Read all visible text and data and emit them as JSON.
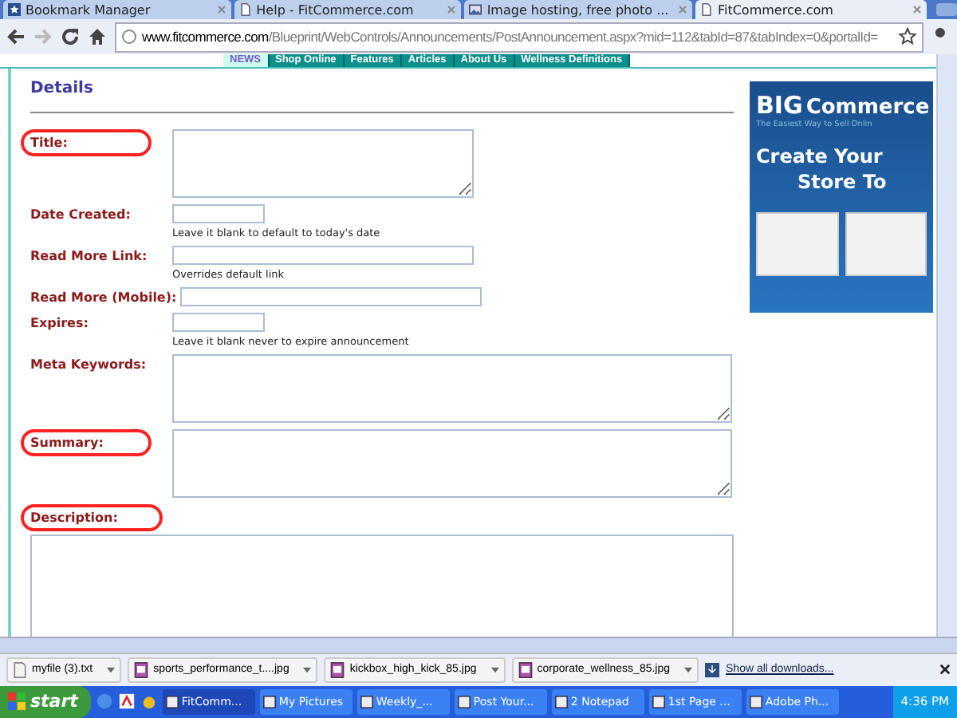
{
  "browser": {
    "tabs": [
      {
        "label": "Bookmark Manager",
        "selected": false
      },
      {
        "label": "Help - FitCommerce.com",
        "selected": false
      },
      {
        "label": "Image hosting, free photo ...",
        "selected": false
      },
      {
        "label": "FitCommerce.com",
        "selected": true
      }
    ],
    "url_host": "www.fitcommerce.com",
    "url_path": "/Blueprint/WebControls/Announcements/PostAnnouncement.aspx?mid=112&tabId=87&tabIndex=0&portalId="
  },
  "site_nav": [
    {
      "label": "NEWS",
      "selected": true
    },
    {
      "label": "Shop Online",
      "selected": false
    },
    {
      "label": "Features",
      "selected": false
    },
    {
      "label": "Articles",
      "selected": false
    },
    {
      "label": "About Us",
      "selected": false
    },
    {
      "label": "Wellness Definitions",
      "selected": false
    }
  ],
  "form": {
    "heading": "Details",
    "fields": [
      {
        "label": "Title:",
        "kind": "box",
        "circled": true
      },
      {
        "label": "Date Created:",
        "kind": "date",
        "hint": "Leave it blank to default to today's date",
        "circled": false
      },
      {
        "label": "Read More Link:",
        "kind": "line",
        "hint": "Overrides default link",
        "circled": false
      },
      {
        "label": "Read More (Mobile):",
        "kind": "line",
        "circled": false
      },
      {
        "label": "Expires:",
        "kind": "date",
        "hint": "Leave it blank never to expire announcement",
        "circled": false
      },
      {
        "label": "Meta Keywords:",
        "kind": "memo",
        "circled": false
      },
      {
        "label": "Summary:",
        "kind": "memo",
        "circled": true
      },
      {
        "label": "Description:",
        "kind": "editor",
        "circled": true
      }
    ]
  },
  "ad": {
    "brand_big": "BIG",
    "brand": "Commerce",
    "tagline": "The Easiest Way to Sell Onlin",
    "headline_1": "Create Your",
    "headline_2": "Store To"
  },
  "downloads": {
    "items": [
      {
        "name": "myfile (3).txt",
        "kind": "text"
      },
      {
        "name": "sports_performance_t....jpg",
        "kind": "image"
      },
      {
        "name": "kickbox_high_kick_85.jpg",
        "kind": "image"
      },
      {
        "name": "corporate_wellness_85.jpg",
        "kind": "image"
      }
    ],
    "show_all": "Show all downloads..."
  },
  "taskbar": {
    "start": "start",
    "tasks": [
      {
        "label": "FitComm...",
        "selected": true
      },
      {
        "label": "My Pictures",
        "selected": false
      },
      {
        "label": "Weekly_...",
        "selected": false
      },
      {
        "label": "Post Your...",
        "selected": false
      },
      {
        "label": "2 Notepad",
        "selected": false
      },
      {
        "label": "1st Page ...",
        "selected": false
      },
      {
        "label": "Adobe Ph...",
        "selected": false
      }
    ],
    "clock": "4:36 PM"
  }
}
